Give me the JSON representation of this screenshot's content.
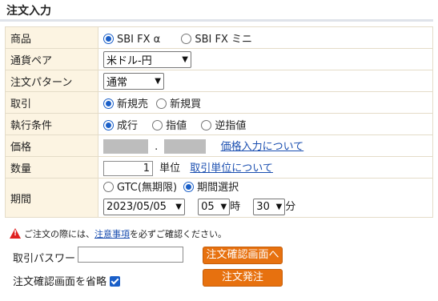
{
  "page_title": "注文入力",
  "rows": {
    "product": {
      "label": "商品",
      "options": [
        "SBI FX α",
        "SBI FX ミニ"
      ],
      "selected": 0
    },
    "currency_pair": {
      "label": "通貨ペア",
      "value": "米ドル-円"
    },
    "order_pattern": {
      "label": "注文パターン",
      "value": "通常"
    },
    "trade": {
      "label": "取引",
      "options": [
        "新規売",
        "新規買"
      ],
      "selected": 0
    },
    "execution": {
      "label": "執行条件",
      "options": [
        "成行",
        "指値",
        "逆指値"
      ],
      "selected": 0
    },
    "price": {
      "label": "価格",
      "separator": ".",
      "link": "価格入力について"
    },
    "quantity": {
      "label": "数量",
      "value": "1",
      "unit": "単位",
      "link": "取引単位について"
    },
    "period": {
      "label": "期間",
      "options": [
        "GTC(無期限)",
        "期間選択"
      ],
      "selected": 1,
      "date": "2023/05/05",
      "hour": "05",
      "hour_unit": "時",
      "minute": "30",
      "minute_unit": "分"
    }
  },
  "notice": {
    "prefix": "ご注文の際には、",
    "link": "注意事項",
    "suffix": "を必ずご確認ください。"
  },
  "password_label": "取引パスワード",
  "skip_confirm_label": "注文確認画面を省略",
  "skip_confirm_checked": true,
  "confirm_button": "注文確認画面へ",
  "order_button": "注文発注"
}
